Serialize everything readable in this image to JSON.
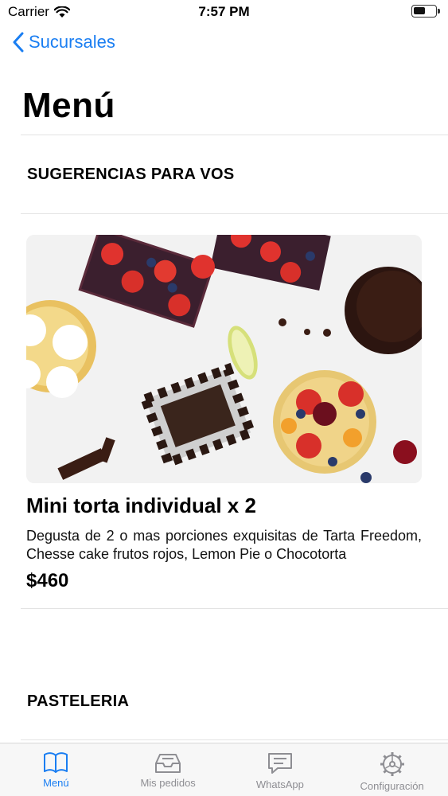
{
  "status_bar": {
    "carrier": "Carrier",
    "time": "7:57 PM",
    "battery_level": 0.55
  },
  "nav": {
    "back_label": "Sucursales",
    "title": "Menú"
  },
  "sections": [
    {
      "title": "SUGERENCIAS PARA VOS"
    },
    {
      "title": "PASTELERIA"
    }
  ],
  "product": {
    "name": "Mini torta individual x 2",
    "description": "Degusta de 2 o mas porciones exquisitas de Tarta Freedom, Chesse cake frutos rojos, Lemon Pie o Chocotorta",
    "price": "$460"
  },
  "tabs": [
    {
      "label": "Menú",
      "icon": "book-icon",
      "active": true
    },
    {
      "label": "Mis pedidos",
      "icon": "inbox-icon",
      "active": false
    },
    {
      "label": "WhatsApp",
      "icon": "chat-icon",
      "active": false
    },
    {
      "label": "Configuración",
      "icon": "gear-icon",
      "active": false
    }
  ],
  "colors": {
    "accent": "#1a7ef2",
    "inactive": "#8e8e93"
  }
}
